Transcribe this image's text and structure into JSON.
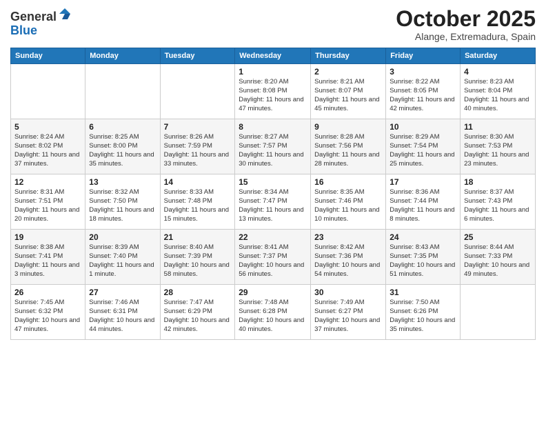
{
  "logo": {
    "general": "General",
    "blue": "Blue"
  },
  "header": {
    "month": "October 2025",
    "location": "Alange, Extremadura, Spain"
  },
  "weekdays": [
    "Sunday",
    "Monday",
    "Tuesday",
    "Wednesday",
    "Thursday",
    "Friday",
    "Saturday"
  ],
  "weeks": [
    [
      {
        "day": "",
        "sunrise": "",
        "sunset": "",
        "daylight": ""
      },
      {
        "day": "",
        "sunrise": "",
        "sunset": "",
        "daylight": ""
      },
      {
        "day": "",
        "sunrise": "",
        "sunset": "",
        "daylight": ""
      },
      {
        "day": "1",
        "sunrise": "8:20 AM",
        "sunset": "8:08 PM",
        "daylight": "11 hours and 47 minutes."
      },
      {
        "day": "2",
        "sunrise": "8:21 AM",
        "sunset": "8:07 PM",
        "daylight": "11 hours and 45 minutes."
      },
      {
        "day": "3",
        "sunrise": "8:22 AM",
        "sunset": "8:05 PM",
        "daylight": "11 hours and 42 minutes."
      },
      {
        "day": "4",
        "sunrise": "8:23 AM",
        "sunset": "8:04 PM",
        "daylight": "11 hours and 40 minutes."
      }
    ],
    [
      {
        "day": "5",
        "sunrise": "8:24 AM",
        "sunset": "8:02 PM",
        "daylight": "11 hours and 37 minutes."
      },
      {
        "day": "6",
        "sunrise": "8:25 AM",
        "sunset": "8:00 PM",
        "daylight": "11 hours and 35 minutes."
      },
      {
        "day": "7",
        "sunrise": "8:26 AM",
        "sunset": "7:59 PM",
        "daylight": "11 hours and 33 minutes."
      },
      {
        "day": "8",
        "sunrise": "8:27 AM",
        "sunset": "7:57 PM",
        "daylight": "11 hours and 30 minutes."
      },
      {
        "day": "9",
        "sunrise": "8:28 AM",
        "sunset": "7:56 PM",
        "daylight": "11 hours and 28 minutes."
      },
      {
        "day": "10",
        "sunrise": "8:29 AM",
        "sunset": "7:54 PM",
        "daylight": "11 hours and 25 minutes."
      },
      {
        "day": "11",
        "sunrise": "8:30 AM",
        "sunset": "7:53 PM",
        "daylight": "11 hours and 23 minutes."
      }
    ],
    [
      {
        "day": "12",
        "sunrise": "8:31 AM",
        "sunset": "7:51 PM",
        "daylight": "11 hours and 20 minutes."
      },
      {
        "day": "13",
        "sunrise": "8:32 AM",
        "sunset": "7:50 PM",
        "daylight": "11 hours and 18 minutes."
      },
      {
        "day": "14",
        "sunrise": "8:33 AM",
        "sunset": "7:48 PM",
        "daylight": "11 hours and 15 minutes."
      },
      {
        "day": "15",
        "sunrise": "8:34 AM",
        "sunset": "7:47 PM",
        "daylight": "11 hours and 13 minutes."
      },
      {
        "day": "16",
        "sunrise": "8:35 AM",
        "sunset": "7:46 PM",
        "daylight": "11 hours and 10 minutes."
      },
      {
        "day": "17",
        "sunrise": "8:36 AM",
        "sunset": "7:44 PM",
        "daylight": "11 hours and 8 minutes."
      },
      {
        "day": "18",
        "sunrise": "8:37 AM",
        "sunset": "7:43 PM",
        "daylight": "11 hours and 6 minutes."
      }
    ],
    [
      {
        "day": "19",
        "sunrise": "8:38 AM",
        "sunset": "7:41 PM",
        "daylight": "11 hours and 3 minutes."
      },
      {
        "day": "20",
        "sunrise": "8:39 AM",
        "sunset": "7:40 PM",
        "daylight": "11 hours and 1 minute."
      },
      {
        "day": "21",
        "sunrise": "8:40 AM",
        "sunset": "7:39 PM",
        "daylight": "10 hours and 58 minutes."
      },
      {
        "day": "22",
        "sunrise": "8:41 AM",
        "sunset": "7:37 PM",
        "daylight": "10 hours and 56 minutes."
      },
      {
        "day": "23",
        "sunrise": "8:42 AM",
        "sunset": "7:36 PM",
        "daylight": "10 hours and 54 minutes."
      },
      {
        "day": "24",
        "sunrise": "8:43 AM",
        "sunset": "7:35 PM",
        "daylight": "10 hours and 51 minutes."
      },
      {
        "day": "25",
        "sunrise": "8:44 AM",
        "sunset": "7:33 PM",
        "daylight": "10 hours and 49 minutes."
      }
    ],
    [
      {
        "day": "26",
        "sunrise": "7:45 AM",
        "sunset": "6:32 PM",
        "daylight": "10 hours and 47 minutes."
      },
      {
        "day": "27",
        "sunrise": "7:46 AM",
        "sunset": "6:31 PM",
        "daylight": "10 hours and 44 minutes."
      },
      {
        "day": "28",
        "sunrise": "7:47 AM",
        "sunset": "6:29 PM",
        "daylight": "10 hours and 42 minutes."
      },
      {
        "day": "29",
        "sunrise": "7:48 AM",
        "sunset": "6:28 PM",
        "daylight": "10 hours and 40 minutes."
      },
      {
        "day": "30",
        "sunrise": "7:49 AM",
        "sunset": "6:27 PM",
        "daylight": "10 hours and 37 minutes."
      },
      {
        "day": "31",
        "sunrise": "7:50 AM",
        "sunset": "6:26 PM",
        "daylight": "10 hours and 35 minutes."
      },
      {
        "day": "",
        "sunrise": "",
        "sunset": "",
        "daylight": ""
      }
    ]
  ]
}
